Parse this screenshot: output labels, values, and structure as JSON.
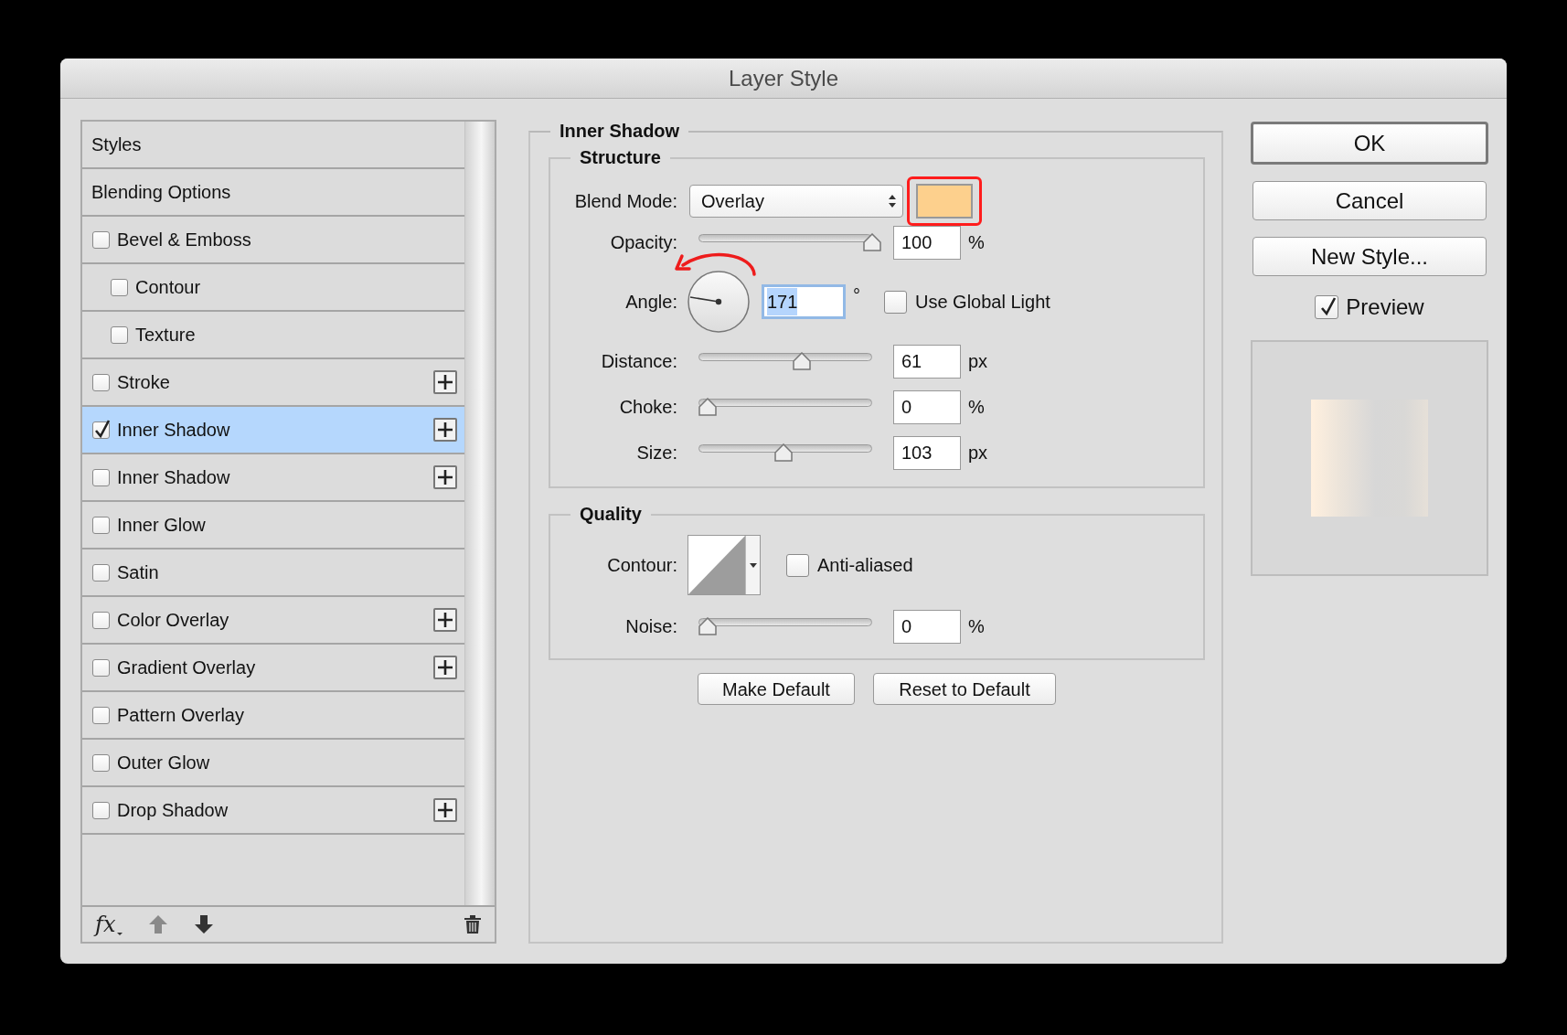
{
  "window": {
    "title": "Layer Style"
  },
  "sidebar": {
    "items": [
      {
        "kind": "header",
        "label": "Styles",
        "selected": false
      },
      {
        "kind": "header",
        "label": "Blending Options",
        "selected": false
      },
      {
        "kind": "option",
        "label": "Bevel & Emboss",
        "checked": false,
        "selected": false,
        "add_button": false,
        "children": [
          {
            "kind": "option",
            "label": "Contour",
            "checked": false,
            "selected": false,
            "add_button": false
          },
          {
            "kind": "option",
            "label": "Texture",
            "checked": false,
            "selected": false,
            "add_button": false
          }
        ]
      },
      {
        "kind": "option",
        "label": "Stroke",
        "checked": false,
        "selected": false,
        "add_button": true
      },
      {
        "kind": "option",
        "label": "Inner Shadow",
        "checked": true,
        "selected": true,
        "add_button": true
      },
      {
        "kind": "option",
        "label": "Inner Shadow",
        "checked": false,
        "selected": false,
        "add_button": true
      },
      {
        "kind": "option",
        "label": "Inner Glow",
        "checked": false,
        "selected": false,
        "add_button": false
      },
      {
        "kind": "option",
        "label": "Satin",
        "checked": false,
        "selected": false,
        "add_button": false
      },
      {
        "kind": "option",
        "label": "Color Overlay",
        "checked": false,
        "selected": false,
        "add_button": true
      },
      {
        "kind": "option",
        "label": "Gradient Overlay",
        "checked": false,
        "selected": false,
        "add_button": true
      },
      {
        "kind": "option",
        "label": "Pattern Overlay",
        "checked": false,
        "selected": false,
        "add_button": false
      },
      {
        "kind": "option",
        "label": "Outer Glow",
        "checked": false,
        "selected": false,
        "add_button": false
      },
      {
        "kind": "option",
        "label": "Drop Shadow",
        "checked": false,
        "selected": false,
        "add_button": true
      }
    ],
    "toolbar": {
      "effects_label": "fx",
      "move_up_disabled": true,
      "move_down_disabled": false
    }
  },
  "inner_shadow": {
    "title": "Inner Shadow",
    "structure": {
      "title": "Structure",
      "blend_mode": {
        "label": "Blend Mode:",
        "value": "Overlay",
        "color": "#fdd08d"
      },
      "controls": [
        {
          "kind": "slider",
          "label": "Opacity:",
          "level": 1.0,
          "value": "100",
          "unit": "%"
        },
        {
          "kind": "angle",
          "label": "Angle:",
          "value": "171",
          "value_selected": true,
          "unit": "°",
          "global_light": {
            "label": "Use Global Light",
            "checked": false
          }
        },
        {
          "kind": "slider",
          "label": "Distance:",
          "level": 0.57,
          "value": "61",
          "unit": "px"
        },
        {
          "kind": "slider",
          "label": "Choke:",
          "level": 0.0,
          "value": "0",
          "unit": "%"
        },
        {
          "kind": "slider",
          "label": "Size:",
          "level": 0.46,
          "value": "103",
          "unit": "px"
        }
      ]
    },
    "quality": {
      "title": "Quality",
      "contour": {
        "label": "Contour:",
        "anti_aliased": {
          "label": "Anti-aliased",
          "checked": false
        }
      },
      "noise": {
        "label": "Noise:",
        "level": 0.0,
        "value": "0",
        "unit": "%"
      }
    },
    "buttons": [
      "Make Default",
      "Reset to Default"
    ]
  },
  "actions": [
    {
      "label": "OK",
      "default": true
    },
    {
      "label": "Cancel",
      "default": false
    },
    {
      "label": "New Style...",
      "default": false
    }
  ],
  "preview": {
    "label": "Preview",
    "checked": true
  }
}
